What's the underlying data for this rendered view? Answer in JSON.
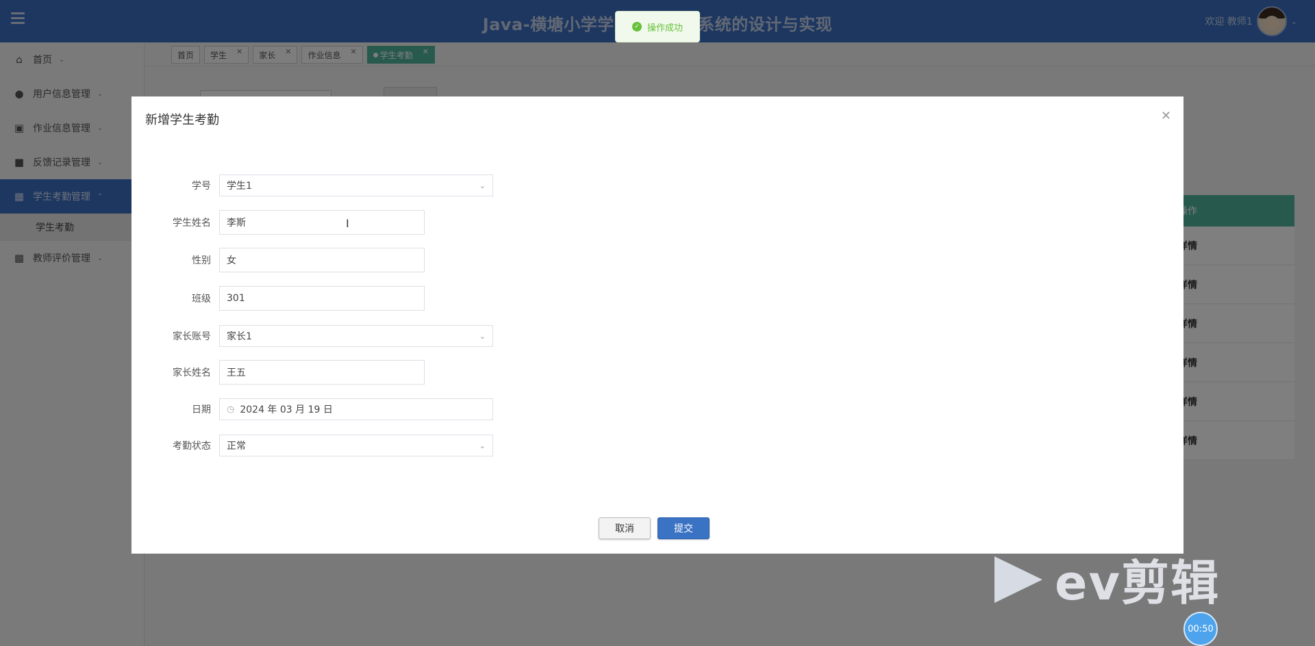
{
  "header": {
    "title": "Java-横塘小学学生家校联系系统的设计与实现",
    "welcome": "欢迎 教师1"
  },
  "sidebar": {
    "items": [
      {
        "label": "首页",
        "icon": "home-icon"
      },
      {
        "label": "用户信息管理",
        "icon": "user-icon"
      },
      {
        "label": "作业信息管理",
        "icon": "card-icon"
      },
      {
        "label": "反馈记录管理",
        "icon": "book-icon"
      },
      {
        "label": "学生考勤管理",
        "icon": "building-icon"
      },
      {
        "label": "教师评价管理",
        "icon": "chip-icon"
      }
    ],
    "sub_item": "学生考勤"
  },
  "tabs": [
    "首页",
    "学生",
    "家长",
    "作业信息",
    "学生考勤"
  ],
  "toast": {
    "text": "操作成功"
  },
  "background": {
    "table_header": "操作",
    "row_action": "详情"
  },
  "dialog": {
    "title": "新增学生考勤",
    "fields": {
      "student_id": {
        "label": "学号",
        "value": "学生1"
      },
      "student_name": {
        "label": "学生姓名",
        "value": "李斯"
      },
      "gender": {
        "label": "性别",
        "value": "女"
      },
      "class": {
        "label": "班级",
        "value": "301"
      },
      "parent_account": {
        "label": "家长账号",
        "value": "家长1"
      },
      "parent_name": {
        "label": "家长姓名",
        "value": "王五"
      },
      "date": {
        "label": "日期",
        "value": "2024 年 03 月 19 日"
      },
      "attendance_status": {
        "label": "考勤状态",
        "value": "正常"
      }
    },
    "cancel_label": "取消",
    "submit_label": "提交"
  },
  "watermark": {
    "text": "ev剪辑"
  },
  "timer": {
    "text": "00:50"
  },
  "colors": {
    "header": "#3a6fc2",
    "accent": "#4eb59b",
    "primary": "#3a72c4",
    "success": "#67c23a"
  }
}
